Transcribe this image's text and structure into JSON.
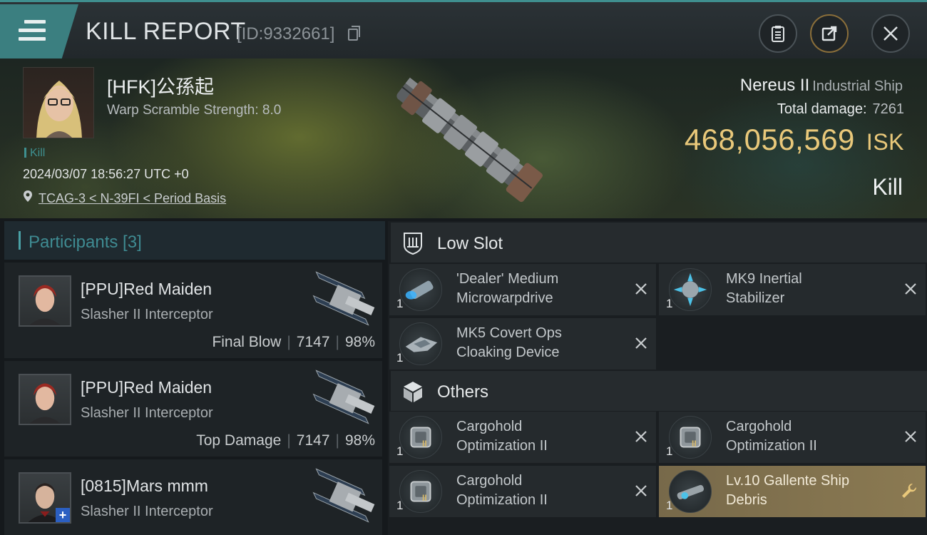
{
  "header": {
    "title": "KILL REPORT",
    "report_id": "[ID:9332661]"
  },
  "victim": {
    "pilot_name": "[HFK]公孫起",
    "warp_scramble": "Warp Scramble Strength: 8.0",
    "kill_tag": "Kill",
    "timestamp": "2024/03/07 18:56:27 UTC +0",
    "location": "TCAG-3 < N-39FI < Period Basis",
    "ship_name": "Nereus II",
    "ship_class": "Industrial Ship",
    "total_damage_label": "Total damage:",
    "total_damage": "7261",
    "isk_value": "468,056,569",
    "isk_unit": "ISK",
    "result": "Kill"
  },
  "participants": {
    "title": "Participants [3]",
    "items": [
      {
        "name": "[PPU]Red Maiden",
        "ship": "Slasher II Interceptor",
        "role": "Final Blow",
        "damage": "7147",
        "percent": "98%"
      },
      {
        "name": "[PPU]Red Maiden",
        "ship": "Slasher II Interceptor",
        "role": "Top Damage",
        "damage": "7147",
        "percent": "98%"
      },
      {
        "name": "[0815]Mars mmm",
        "ship": "Slasher II Interceptor"
      }
    ]
  },
  "modules": {
    "low_slot": {
      "title": "Low Slot",
      "items": [
        {
          "qty": "1",
          "line1": "'Dealer' Medium",
          "line2": "Microwarpdrive",
          "status": "destroyed"
        },
        {
          "qty": "1",
          "line1": "MK9 Inertial",
          "line2": "Stabilizer",
          "status": "destroyed"
        },
        {
          "qty": "1",
          "line1": "MK5 Covert Ops",
          "line2": "Cloaking Device",
          "status": "destroyed"
        }
      ]
    },
    "others": {
      "title": "Others",
      "items": [
        {
          "qty": "1",
          "line1": "Cargohold",
          "line2": "Optimization II",
          "status": "destroyed"
        },
        {
          "qty": "1",
          "line1": "Cargohold",
          "line2": "Optimization II",
          "status": "destroyed"
        },
        {
          "qty": "1",
          "line1": "Cargohold",
          "line2": "Optimization II",
          "status": "destroyed"
        },
        {
          "qty": "1",
          "line1": "Lv.10 Gallente Ship",
          "line2": "Debris",
          "status": "dropped"
        }
      ]
    }
  },
  "colors": {
    "accent_teal": "#3b7f80",
    "isk_gold": "#e9c87a",
    "dropped_item": "#8b7a52"
  }
}
